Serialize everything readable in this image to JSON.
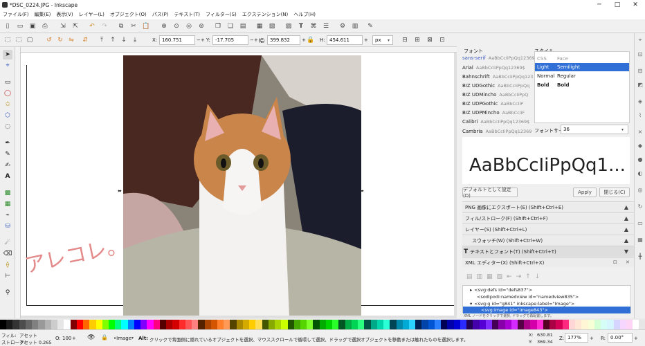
{
  "window": {
    "title": "*DSC_0224.JPG - Inkscape",
    "min": "─",
    "max": "□",
    "close": "✕"
  },
  "menu": [
    "ファイル(F)",
    "編集(E)",
    "表示(V)",
    "レイヤー(L)",
    "オブジェクト(O)",
    "パス(P)",
    "テキスト(T)",
    "フィルター(S)",
    "エクステンション(N)",
    "ヘルプ(H)"
  ],
  "controls": {
    "x_label": "X:",
    "x": "160.751",
    "y_label": "Y:",
    "y": "-17.705",
    "w_label": "幅:",
    "w": "399.832",
    "h_label": "H:",
    "h": "454.611",
    "unit": "px",
    "plus": "+",
    "minus": "−"
  },
  "font_dock": {
    "font_header": "フォント",
    "style_header": "スタイル",
    "fonts": [
      {
        "name": "sans-serif",
        "sample": "AaBbCcIiPpQq12369"
      },
      {
        "name": "Arial",
        "sample": "AaBbCcIiPpQq12369$"
      },
      {
        "name": "Bahnschrift",
        "sample": "AaBbCcIiPpQq123"
      },
      {
        "name": "BIZ UDGothic",
        "sample": "AaBbCcIiPpQq"
      },
      {
        "name": "BIZ UDMincho",
        "sample": "AaBbCcIiPpQ"
      },
      {
        "name": "BIZ UDPGothic",
        "sample": "AaBbCcIiP"
      },
      {
        "name": "BIZ UDPMincho",
        "sample": "AaBbCcIiF"
      },
      {
        "name": "Calibri",
        "sample": "AaBbCcIiPpQq12369$"
      },
      {
        "name": "Cambria",
        "sample": "AaBbCcIiPpQq12369"
      }
    ],
    "styles": [
      {
        "css": "CSS",
        "face": "Face"
      },
      {
        "css": "Light",
        "face": "Semilight"
      },
      {
        "css": "Normal",
        "face": "Regular"
      },
      {
        "css": "Bold",
        "face": "Bold"
      }
    ],
    "size_label": "フォントサイズ",
    "size": "36",
    "preview": "AaBbCcIiPpQq1...",
    "set_default": "デフォルトとして設定(D)",
    "apply": "Apply",
    "close": "閉じる(C)"
  },
  "dialogs": [
    {
      "label": "PNG 画像にエクスポート(E) (Shift+Ctrl+E)"
    },
    {
      "label": "フィル/ストローク(F) (Shift+Ctrl+F)"
    },
    {
      "label": "レイヤー(S) (Shift+Ctrl+L)"
    },
    {
      "label": "スウォッチ(W) (Shift+Ctrl+W)"
    },
    {
      "label": "テキストとフォント(T) (Shift+Ctrl+T)"
    }
  ],
  "xml_editor": {
    "title": "XML エディター(X) (Shift+Ctrl+X)",
    "nodes": [
      "<svg:defs id=\"defs837\">",
      "<sodipodi:namedview id=\"namedview835\">",
      "<svg:g id=\"g841\" inkscape:label=\"Image\">",
      "<svg:image id=\"image843\">"
    ],
    "hint": "XML ノードをクリックで選択, ドラッグで再配置します。"
  },
  "status": {
    "fill_label": "フィル:",
    "fill_value": "アセット",
    "stroke_label": "ストローク:",
    "stroke_value": "アセット 0.265",
    "opacity_label": "O:",
    "opacity": "100",
    "layer": "•Image",
    "message_alt": "Alt:",
    "message": "クリックで背面側に隠れているオブジェクトを選択、マウススクロールで循環して選択、ドラッグで選択オブジェクトを移動または触れたものを選択します。",
    "x_label": "X:",
    "cx": "630.81",
    "y_label": "Y:",
    "cy": "369.34",
    "zoom_label": "Z:",
    "zoom": "177%",
    "rot_label": "R:",
    "rotate": "0.00°"
  },
  "handwriting": "アレコレ。",
  "palette_colors": [
    "#000000",
    "#1a1a1a",
    "#333333",
    "#4d4d4d",
    "#666666",
    "#808080",
    "#999999",
    "#b3b3b3",
    "#cccccc",
    "#e6e6e6",
    "#ffffff",
    "#800000",
    "#ff0000",
    "#ff6600",
    "#ffcc00",
    "#ffff00",
    "#80ff00",
    "#00ff00",
    "#00ff80",
    "#00ffff",
    "#0080ff",
    "#0000ff",
    "#8000ff",
    "#ff00ff",
    "#ff0080",
    "#550000",
    "#aa0000",
    "#d40000",
    "#ff2a2a",
    "#ff5555",
    "#ff8080",
    "#552200",
    "#aa4400",
    "#d45500",
    "#ff7f2a",
    "#ff9955",
    "#554400",
    "#aa8800",
    "#d4aa00",
    "#ffcc00",
    "#ffdd55",
    "#445500",
    "#88aa00",
    "#aad400",
    "#ccff00",
    "#225500",
    "#44aa00",
    "#55d400",
    "#7fff2a",
    "#005500",
    "#00aa00",
    "#00d400",
    "#2aff2a",
    "#005522",
    "#00aa44",
    "#00d455",
    "#2aff80",
    "#005544",
    "#00aa88",
    "#00d4aa",
    "#2affd5",
    "#004455",
    "#0088aa",
    "#00aad4",
    "#2ad4ff",
    "#002255",
    "#0044aa",
    "#0055d4",
    "#2a7fff",
    "#000055",
    "#0000aa",
    "#0000d4",
    "#2a2aff",
    "#220055",
    "#4400aa",
    "#5500d4",
    "#7f2aff",
    "#440055",
    "#8800aa",
    "#aa00d4",
    "#d42aff",
    "#550044",
    "#aa0088",
    "#d400aa",
    "#ff2ad4",
    "#550022",
    "#aa0044",
    "#d40055",
    "#ff2a7f",
    "#ffd5d5",
    "#ffe6d5",
    "#fff6d5",
    "#f6ffd5",
    "#d5ffd5",
    "#d5fff6",
    "#d5f6ff",
    "#d5d5ff",
    "#f6d5ff",
    "#ffd5f6",
    "#ffffff",
    "#e6e6e6"
  ]
}
